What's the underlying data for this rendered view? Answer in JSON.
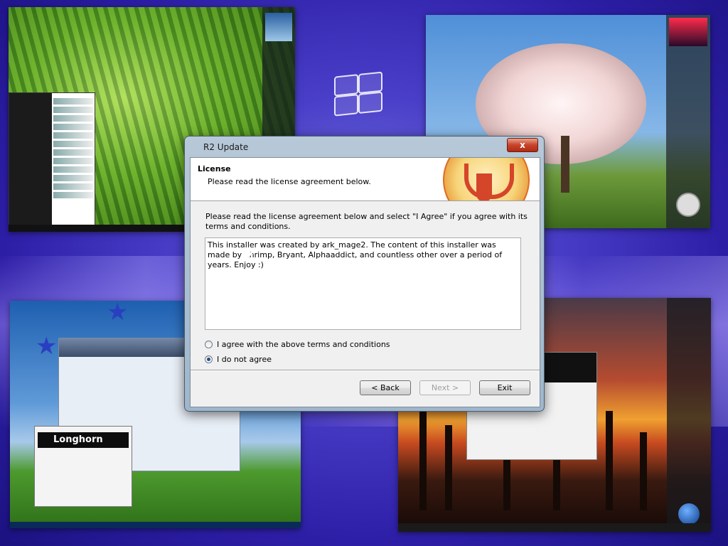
{
  "dialog": {
    "title": "R2 Update",
    "close_glyph": "x",
    "header_title": "License",
    "header_subtitle": "Please read the license agreement below.",
    "intro_text": "Please read the license agreement below and select \"I Agree\" if you agree with its terms and conditions.",
    "license_text": "This installer was created by ark_mage2. The content of this installer was made by Shrimp, Bryant, Alphaaddict, and countless other over a period of years. Enjoy :)",
    "options": [
      {
        "label": "I agree with the above terms and conditions",
        "checked": false
      },
      {
        "label": "I do not agree",
        "checked": true
      }
    ],
    "buttons": {
      "back": "< Back",
      "next": "Next >",
      "exit": "Exit"
    }
  },
  "background": {
    "longhorn_label": "Longhorn",
    "logo_icon": "windows-logo-icon",
    "accent_color": "#3a2bb0"
  }
}
